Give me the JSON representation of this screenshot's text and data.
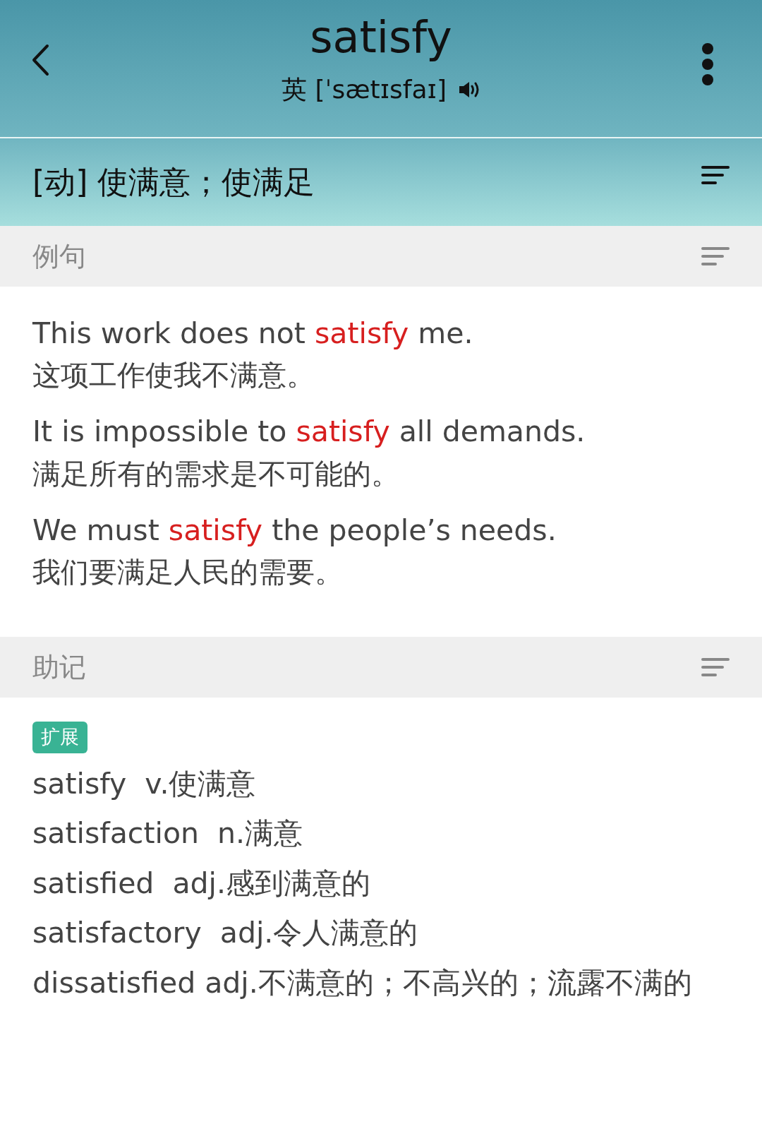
{
  "header": {
    "title": "satisfy",
    "accent": "英",
    "phonetic": "[ˈsætɪsfaɪ]"
  },
  "definition": "[动] 使满意；使满足",
  "sections": [
    {
      "title": "例句",
      "kind": "examples",
      "examples": [
        {
          "before": "This work does not ",
          "highlight": "satisfy",
          "after": " me.",
          "translation": "这项工作使我不满意。"
        },
        {
          "before": "It is impossible to ",
          "highlight": "satisfy",
          "after": " all demands.",
          "translation": "满足所有的需求是不可能的。"
        },
        {
          "before": "We must ",
          "highlight": "satisfy",
          "after": " the people’s needs.",
          "translation": "我们要满足人民的需要。"
        }
      ]
    },
    {
      "title": "助记",
      "kind": "mnemonic",
      "tag": "扩展",
      "lines": [
        "satisfy  v.使满意",
        "satisfaction  n.满意",
        "satisfied  adj.感到满意的",
        "satisfactory  adj.令人满意的",
        "dissatisfied adj.不满意的；不高兴的；流露不满的"
      ]
    }
  ]
}
